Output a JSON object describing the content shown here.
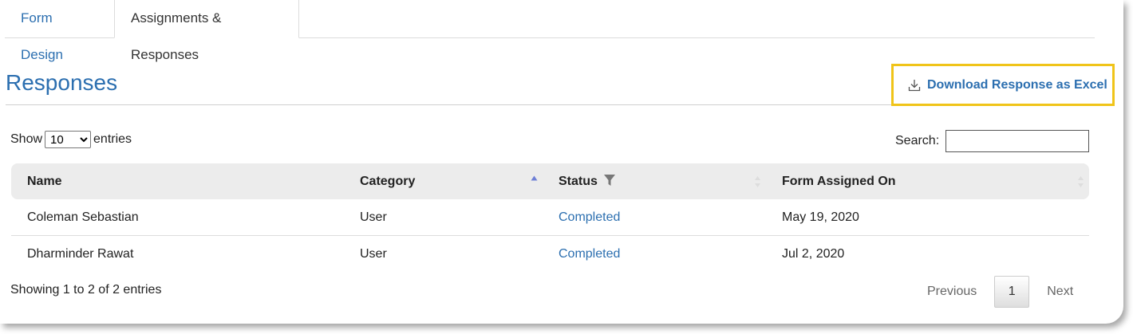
{
  "tabs": [
    {
      "label": "Form Design"
    },
    {
      "label": "Assignments & Responses"
    }
  ],
  "page_title": "Responses",
  "download_label": "Download Response as Excel",
  "length_control": {
    "show_label": "Show",
    "selected": "10",
    "entries_label": "entries"
  },
  "search": {
    "label": "Search:",
    "value": ""
  },
  "table": {
    "columns": [
      "Name",
      "Category",
      "Status",
      "Form Assigned On"
    ],
    "rows": [
      {
        "name": "Coleman Sebastian",
        "category": "User",
        "status": "Completed",
        "assigned_on": "May 19, 2020"
      },
      {
        "name": "Dharminder Rawat",
        "category": "User",
        "status": "Completed",
        "assigned_on": "Jul 2, 2020"
      }
    ]
  },
  "info": "Showing 1 to 2 of 2 entries",
  "pagination": {
    "previous": "Previous",
    "current": "1",
    "next": "Next"
  },
  "colors": {
    "accent": "#2c6fb0",
    "highlight": "#f0c419",
    "header_bg": "#ececec"
  }
}
